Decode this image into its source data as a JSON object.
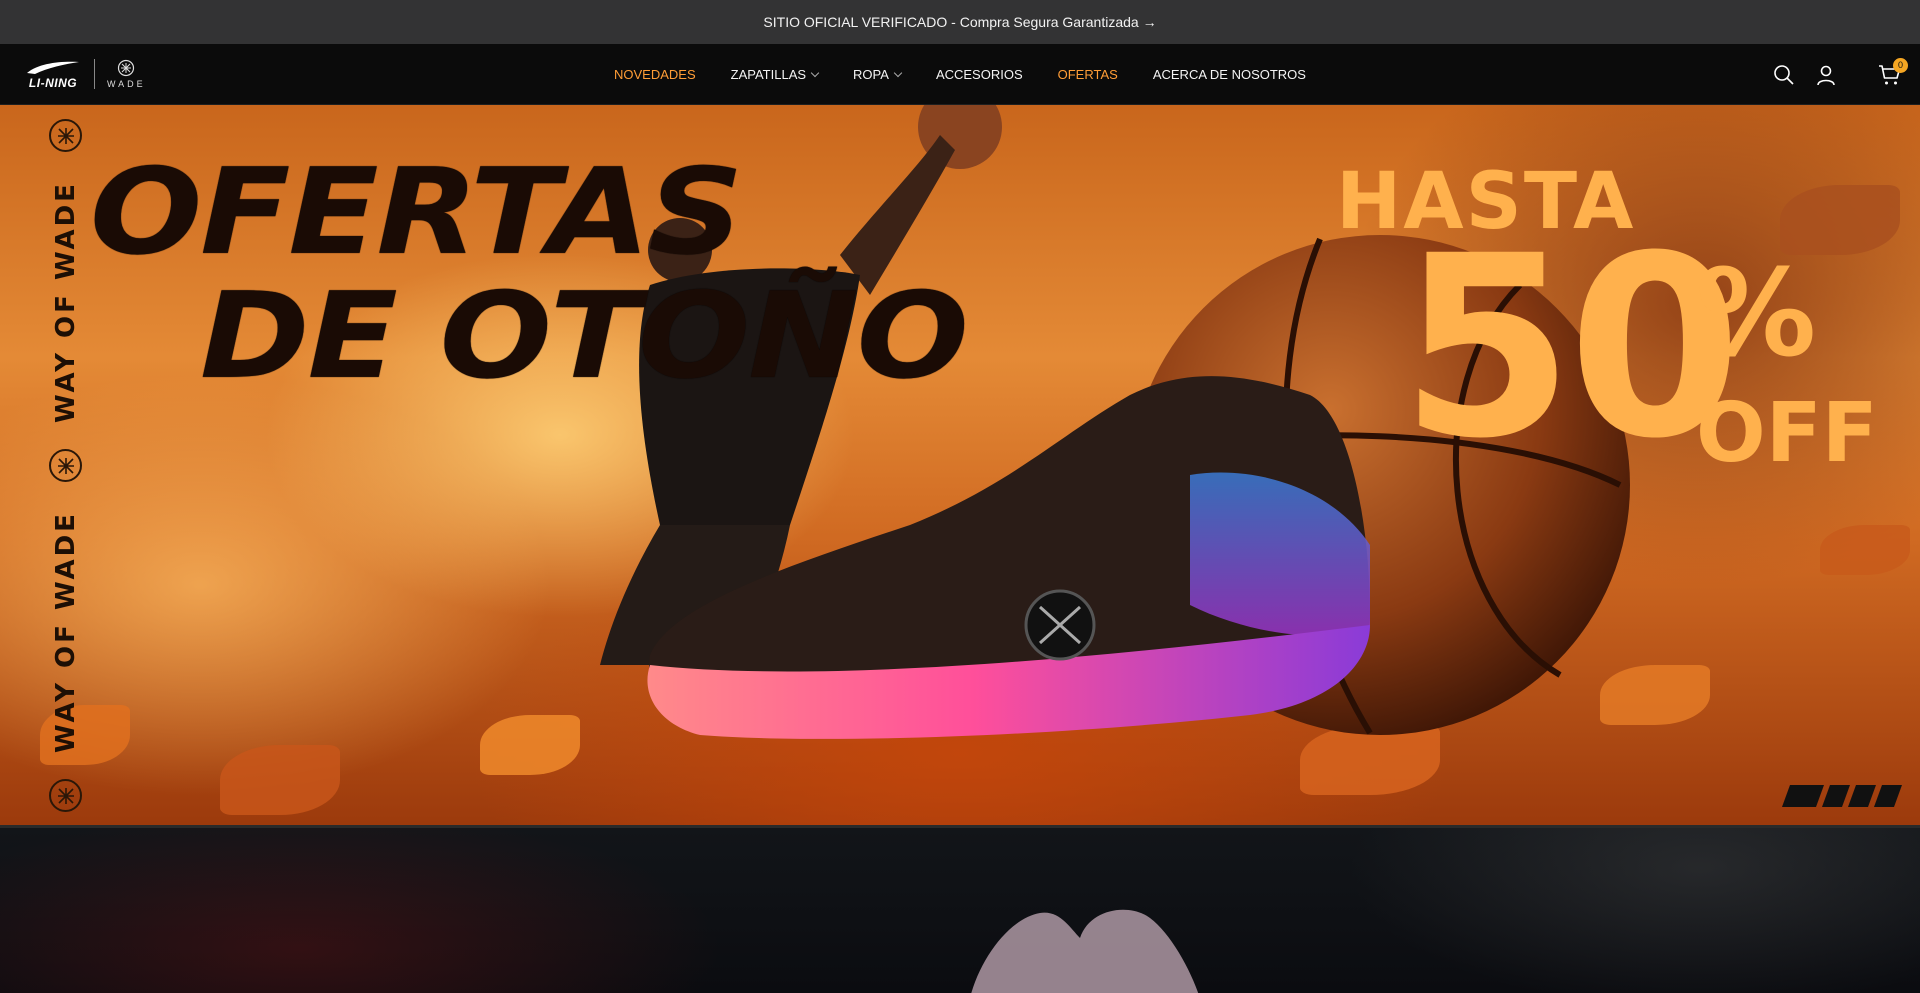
{
  "announcement": {
    "text": "SITIO OFICIAL VERIFICADO - Compra Segura Garantizada →"
  },
  "header": {
    "logo_brand": "LI-NING",
    "logo_sub": "WADE",
    "nav": [
      {
        "label": "NOVEDADES",
        "accent": true,
        "dropdown": false
      },
      {
        "label": "ZAPATILLAS",
        "accent": false,
        "dropdown": true
      },
      {
        "label": "ROPA",
        "accent": false,
        "dropdown": true
      },
      {
        "label": "ACCESORIOS",
        "accent": false,
        "dropdown": false
      },
      {
        "label": "OFERTAS",
        "accent": true,
        "dropdown": false
      },
      {
        "label": "ACERCA DE NOSOTROS",
        "accent": false,
        "dropdown": false
      }
    ],
    "icons": [
      "search-icon",
      "account-icon",
      "cart-icon"
    ],
    "cart_count": "0"
  },
  "hero": {
    "headline_line1": "OFERTAS",
    "headline_line2": "DE OTOÑO",
    "side_text": "WAY OF WADE",
    "promo_hasta": "HASTA",
    "promo_value": "50",
    "promo_percent": "%",
    "promo_off": "OFF"
  },
  "colors": {
    "accent": "#ff9d36",
    "promo": "#ffb14d",
    "announce_bg": "#333334",
    "header_bg": "#0b0b0b",
    "badge": "#f5a623"
  }
}
